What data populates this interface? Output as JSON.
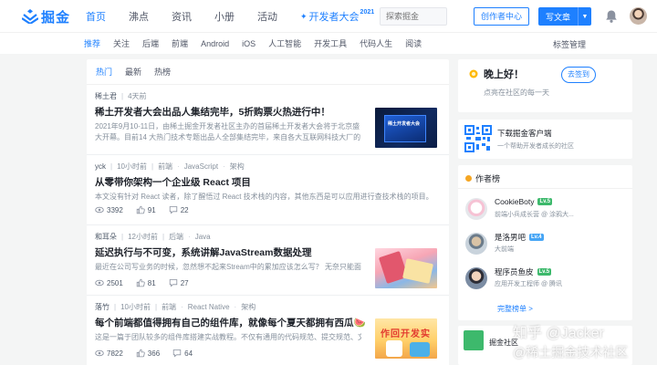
{
  "header": {
    "brand": "掘金",
    "nav": [
      {
        "label": "首页",
        "active": true
      },
      {
        "label": "沸点",
        "active": false
      },
      {
        "label": "资讯",
        "active": false
      },
      {
        "label": "小册",
        "active": false
      },
      {
        "label": "活动",
        "active": false
      }
    ],
    "dev_conference": {
      "label": "开发者大会",
      "year": "2021"
    },
    "search_placeholder": "探索掘金",
    "creator_button": "创作者中心",
    "write_button": "写文章"
  },
  "subnav": {
    "tags": [
      "推荐",
      "关注",
      "后端",
      "前端",
      "Android",
      "iOS",
      "人工智能",
      "开发工具",
      "代码人生",
      "阅读"
    ],
    "active_index": 0,
    "manage": "标签管理"
  },
  "feed": {
    "tabs": [
      "热门",
      "最新",
      "热榜"
    ],
    "active_tab": 0,
    "articles": [
      {
        "author": "稀土君",
        "time": "4天前",
        "tags": [],
        "title": "稀土开发者大会出品人集结完毕，5折购票火热进行中！",
        "brief": "2021年9月10-11日，由稀土掘金开发者社区主办的首届稀土开发者大会将于北京盛大开幕。目前14 大热门技术专题出品人全部集结完毕，来自各大互联网科技大厂的明星讲师...",
        "views": "",
        "likes": "",
        "comments": "",
        "thumb_text": "稀土开发者大会"
      },
      {
        "author": "yck",
        "time": "10小时前",
        "tags": [
          "前端",
          "JavaScript",
          "架构"
        ],
        "title": "从零带你架构一个企业级 React 项目",
        "brief": "本文没有针对 React 读者，除了醒悟过 React 技术栈的内容，其他东西是可以应用进行查技术栈的项目。",
        "views": "3392",
        "likes": "91",
        "comments": "22"
      },
      {
        "author": "和耳朵",
        "time": "12小时前",
        "tags": [
          "后端",
          "Java"
        ],
        "title": "延迟执行与不可变，系统讲解JavaStream数据处理",
        "brief": "最近在公司写业务的时候，忽然想不起来Stream中的累加应该怎么写？ 无奈只能面向谷...",
        "views": "2501",
        "likes": "81",
        "comments": "27"
      },
      {
        "author": "落竹",
        "time": "10小时前",
        "tags": [
          "前端",
          "React Native",
          "架构"
        ],
        "title": "每个前端都值得拥有自己的组件库，就像每个夏天都拥有西瓜🍉",
        "brief": "这是一篇于团队较多的组件库搭建实战教程。不仅有通用的代码规范、提交规范、文档...",
        "views": "7822",
        "likes": "366",
        "comments": "64",
        "thumb_text": "作回开发实"
      }
    ]
  },
  "greeting": {
    "hello": "晚上好！",
    "sign_in": "去签到",
    "hint": "点亮在社区的每一天"
  },
  "download": {
    "title": "下载掘金客户端",
    "subtitle": "一个帮助开发者成长的社区"
  },
  "authors": {
    "heading": "作者榜",
    "list": [
      {
        "name": "CookieBoty",
        "level": "Lv.5",
        "desc": "前端小兵成长营 @ 涂鸦大..."
      },
      {
        "name": "是洛男吧",
        "level": "Lv.4",
        "desc": "大前端"
      },
      {
        "name": "程序员鱼皮",
        "level": "Lv.5",
        "desc": "应用开发工程师 @ 腾讯"
      }
    ],
    "more": "完整榜单 >"
  },
  "community": {
    "label": "掘金社区"
  },
  "watermark": {
    "line1": "知乎 @Jacker",
    "line2": "@稀土掘金技术社区"
  },
  "colors": {
    "accent": "#1e80ff",
    "bg": "#f4f5f5"
  }
}
